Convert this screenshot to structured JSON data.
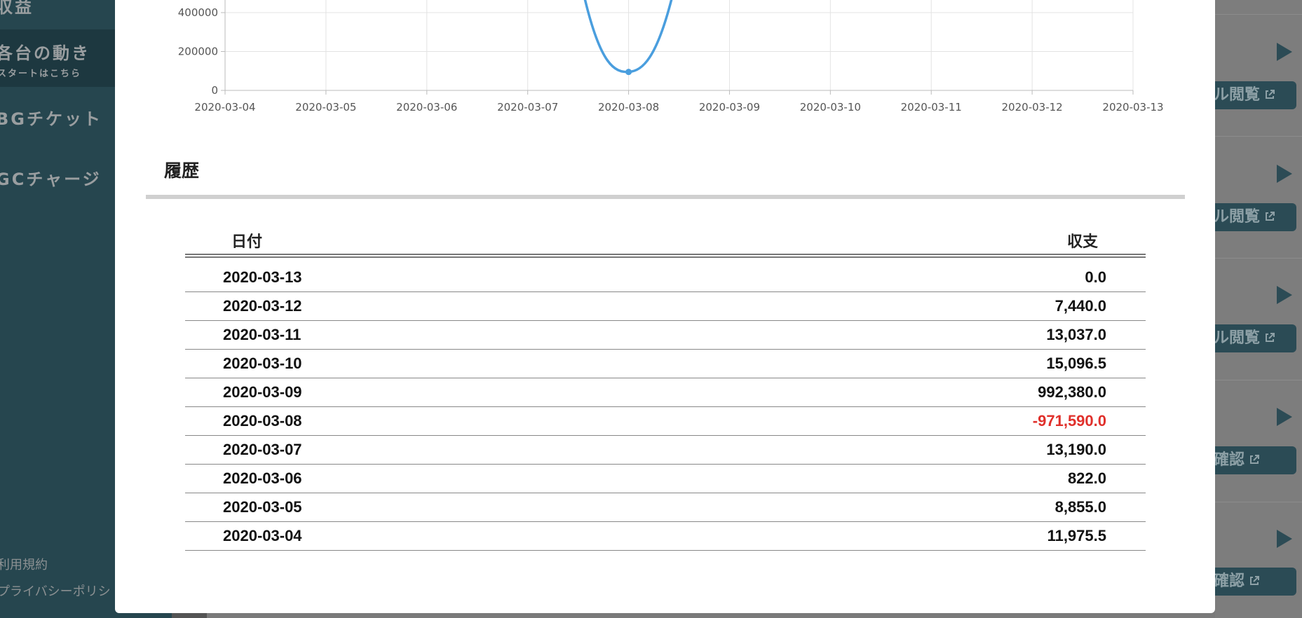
{
  "sidebar": {
    "items": [
      {
        "label": "収益"
      },
      {
        "label": "各台の動き",
        "sub": "スタートはこちら"
      },
      {
        "label": "BGチケット"
      },
      {
        "label": "GCチャージ"
      }
    ],
    "footer_links": [
      "利用規約",
      "プライバシーポリシ"
    ]
  },
  "right_list": {
    "buttons": [
      "ル閲覧",
      "ル閲覧",
      "ル閲覧",
      "確認",
      "確認"
    ]
  },
  "history": {
    "title": "履歴",
    "columns": {
      "date": "日付",
      "amount": "収支"
    },
    "rows": [
      {
        "date": "2020-03-13",
        "amount": "0.0",
        "negative": false
      },
      {
        "date": "2020-03-12",
        "amount": "7,440.0",
        "negative": false
      },
      {
        "date": "2020-03-11",
        "amount": "13,037.0",
        "negative": false
      },
      {
        "date": "2020-03-10",
        "amount": "15,096.5",
        "negative": false
      },
      {
        "date": "2020-03-09",
        "amount": "992,380.0",
        "negative": false
      },
      {
        "date": "2020-03-08",
        "amount": "-971,590.0",
        "negative": true
      },
      {
        "date": "2020-03-07",
        "amount": "13,190.0",
        "negative": false
      },
      {
        "date": "2020-03-06",
        "amount": "822.0",
        "negative": false
      },
      {
        "date": "2020-03-05",
        "amount": "8,855.0",
        "negative": false
      },
      {
        "date": "2020-03-04",
        "amount": "11,975.5",
        "negative": false
      }
    ]
  },
  "colors": {
    "line": "#4a9ede",
    "negative": "#e0302b",
    "sidebar": "#26464f"
  },
  "chart_data": {
    "type": "line",
    "x": [
      "2020-03-04",
      "2020-03-05",
      "2020-03-06",
      "2020-03-07",
      "2020-03-08",
      "2020-03-09",
      "2020-03-10",
      "2020-03-11",
      "2020-03-12",
      "2020-03-13"
    ],
    "y_ticks": [
      "0",
      "200000",
      "400000"
    ],
    "visible_ylim": [
      0,
      470000
    ],
    "grid": true,
    "series": [
      {
        "points": [
          {
            "x": "2020-03-08",
            "y": 95000
          }
        ]
      }
    ]
  }
}
